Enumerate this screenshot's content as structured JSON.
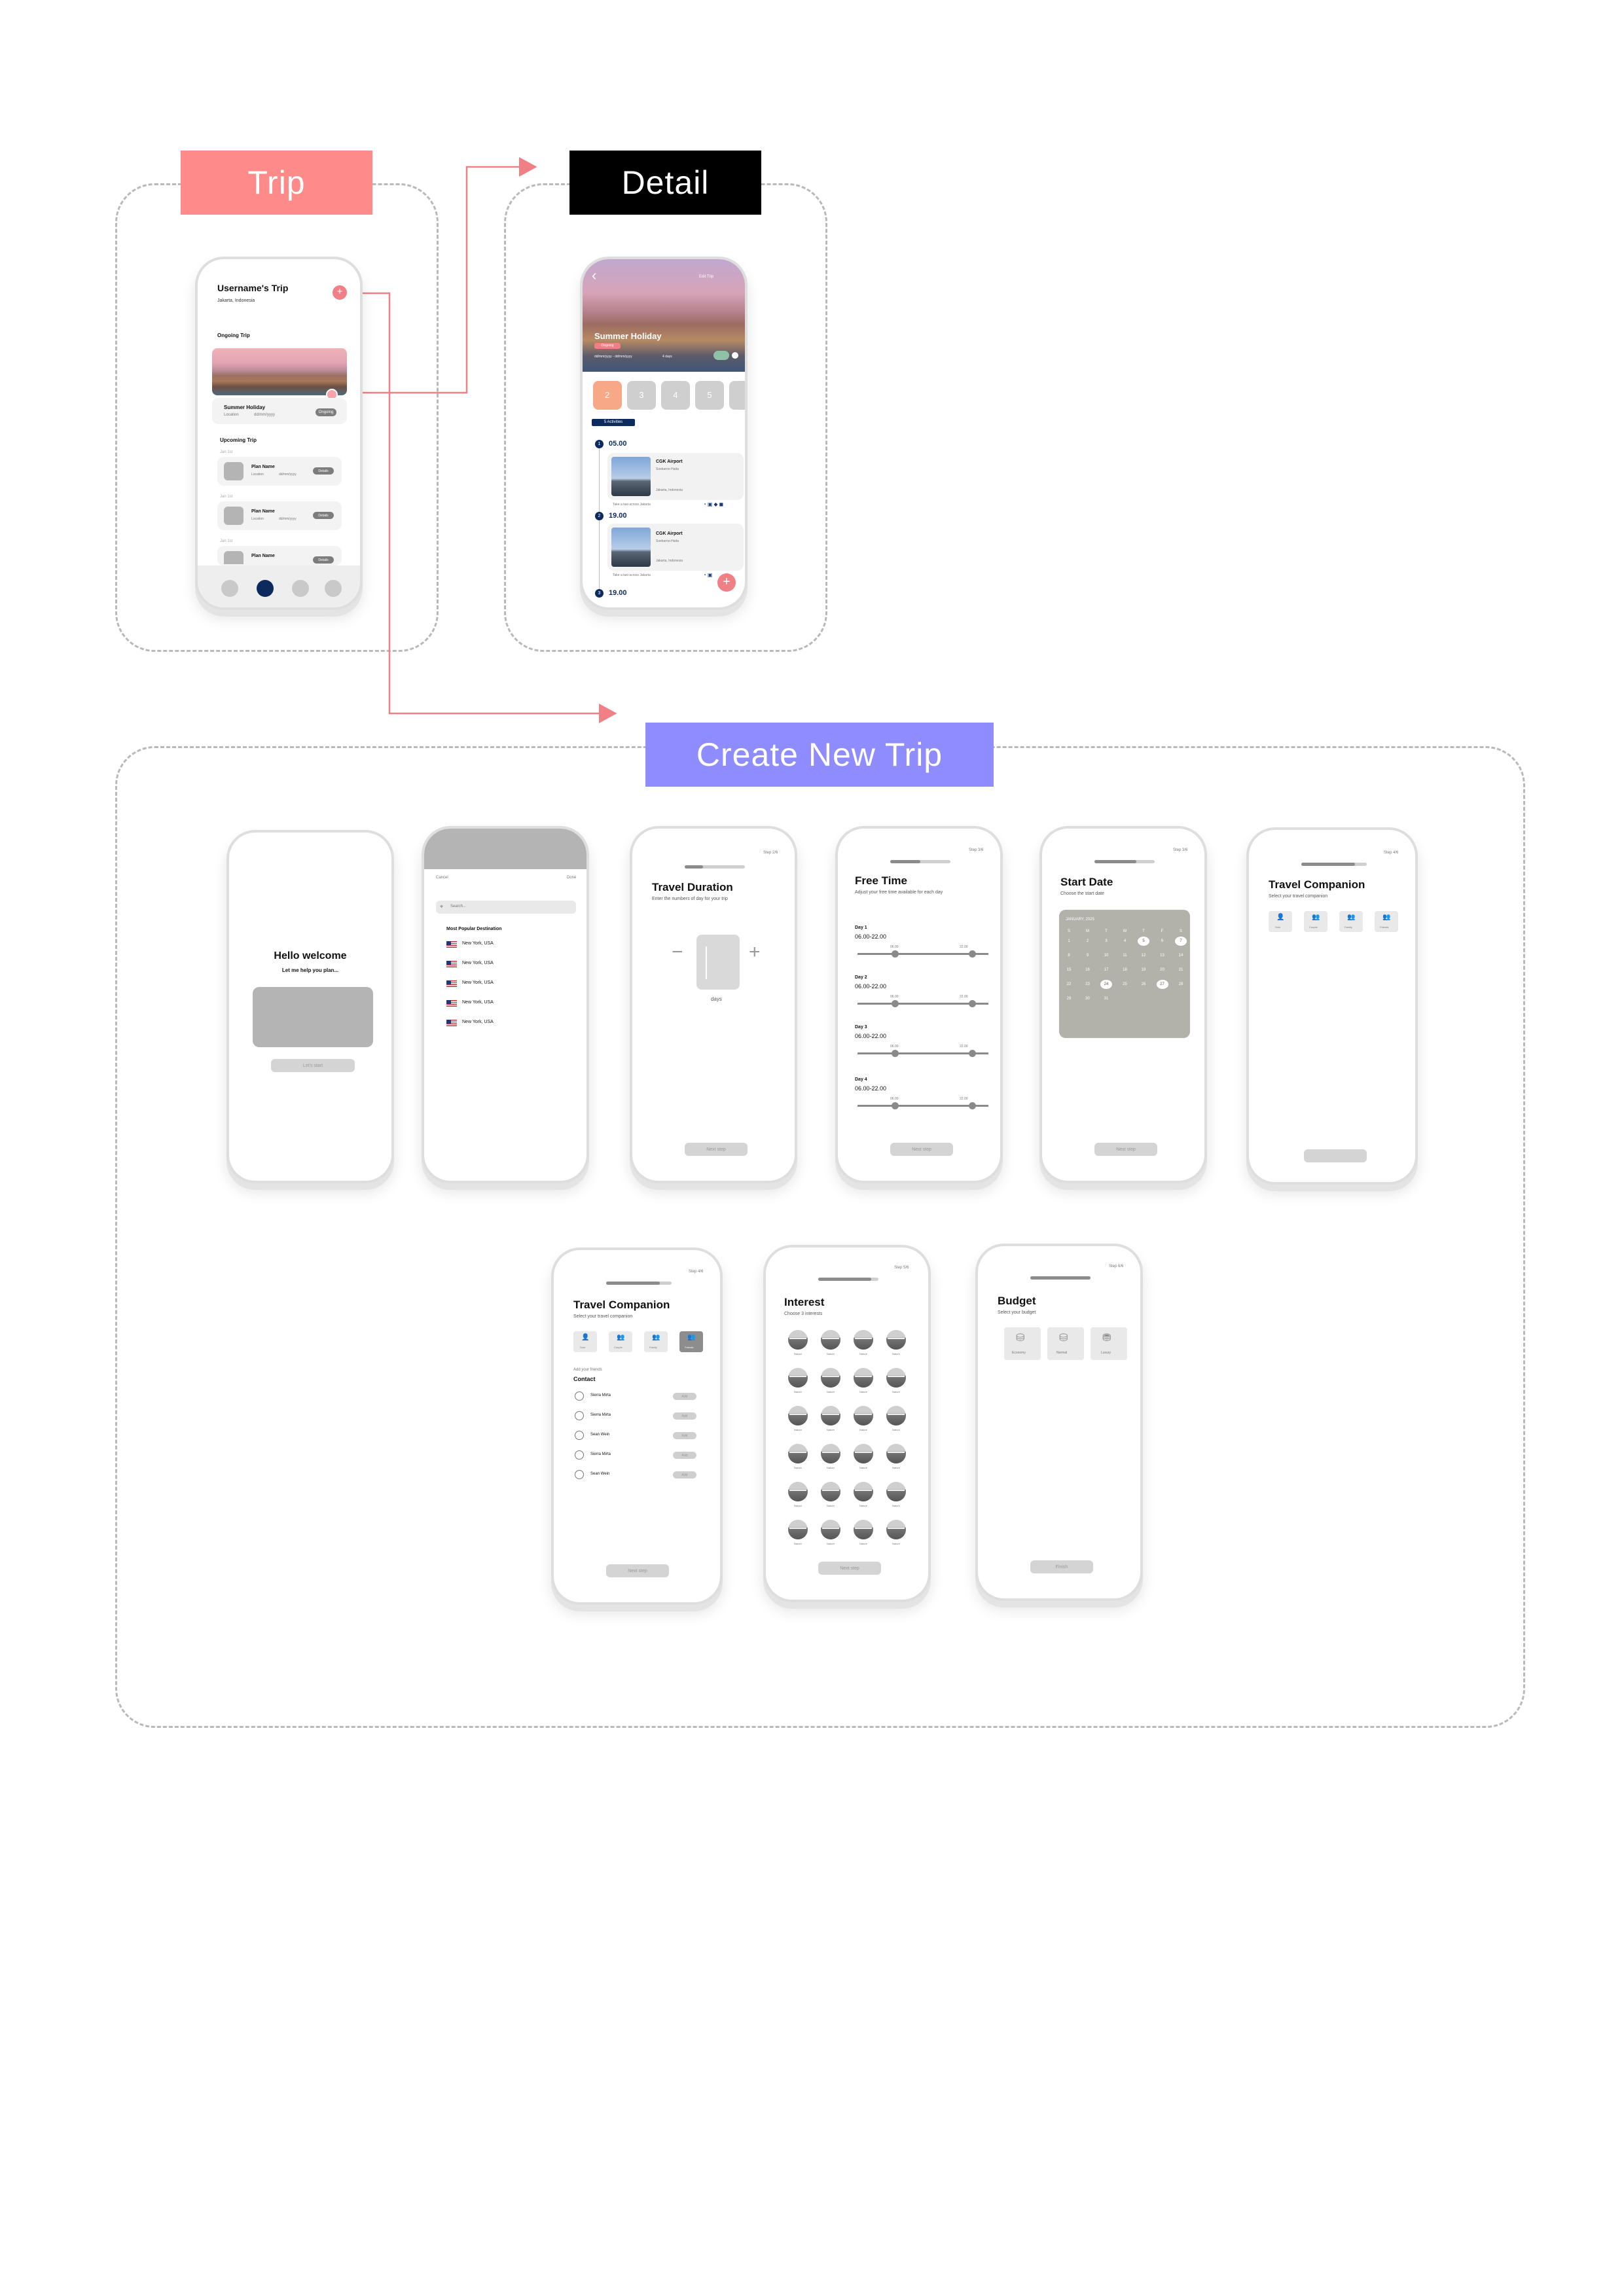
{
  "banners": {
    "trip": "Trip",
    "detail": "Detail",
    "create": "Create New Trip"
  },
  "colors": {
    "trip_banner": "#ff8a8a",
    "detail_banner": "#000000",
    "create_banner": "#8f8cff",
    "connector": "#f07f86",
    "navy": "#0d2a5e"
  },
  "trip_screen": {
    "title": "Username's Trip",
    "location": "Jakarta, Indonesia",
    "ongoing_label": "Ongoing Trip",
    "ongoing": {
      "name": "Summer Holiday",
      "meta_a": "Location",
      "meta_b": "dd/mm/yyyy",
      "tag": "Ongoing"
    },
    "upcoming_label": "Upcoming Trip",
    "upcoming": [
      {
        "date": "Jan 1st",
        "name": "Plan Name",
        "meta_a": "Location",
        "meta_b": "dd/mm/yyyy",
        "tag": "Details"
      },
      {
        "date": "Jan 1st",
        "name": "Plan Name",
        "meta_a": "Location",
        "meta_b": "dd/mm/yyyy",
        "tag": "Details"
      },
      {
        "date": "Jan 1st",
        "name": "Plan Name",
        "meta_a": "",
        "meta_b": "",
        "tag": "Details"
      }
    ]
  },
  "detail_screen": {
    "hero_title": "Summer Holiday",
    "hero_badge": "Ongoing",
    "hero_meta": "dd/mm/yyyy - dd/mm/yyyy",
    "hero_meta2": "4 days",
    "corner_label": "Edit Trip",
    "days": [
      "2",
      "3",
      "4",
      "5"
    ],
    "activities_tag": "5 Activities",
    "timeline": [
      {
        "num": "1",
        "time": "05.00",
        "card_title": "CGK Airport",
        "line_a": "Soekarno-Hatta",
        "line_b": "Jakarta, Indonesia",
        "note": "Take a taxi across Jakarta"
      },
      {
        "num": "2",
        "time": "19.00",
        "card_title": "CGK Airport",
        "line_a": "Soekarno-Hatta",
        "line_b": "Jakarta, Indonesia",
        "note": "Take a taxi across Jakarta"
      },
      {
        "num": "3",
        "time": "19.00"
      }
    ]
  },
  "welcome": {
    "title": "Hello welcome",
    "subtitle": "Let me help you plan...",
    "button": "Let's start"
  },
  "destination": {
    "top_left": "Cancel",
    "top_right": "Done",
    "search": "Search...",
    "heading": "Most Popular Destination",
    "items": [
      "New York, USA",
      "New York, USA",
      "New York, USA",
      "New York, USA",
      "New York, USA"
    ]
  },
  "duration": {
    "step": "Step 2/6",
    "title": "Travel Duration",
    "subtitle": "Enter the numbers of day for your trip",
    "minus": "−",
    "plus": "+",
    "unit": "days",
    "button": "Next step"
  },
  "free_time": {
    "step": "Step 3/6",
    "title": "Free Time",
    "subtitle": "Adjust your free time available for each day",
    "days": [
      {
        "label": "Day 1",
        "range": "06.00-22.00",
        "min": "06.00",
        "max": "22.00"
      },
      {
        "label": "Day 2",
        "range": "06.00-22.00",
        "min": "06.00",
        "max": "22.00"
      },
      {
        "label": "Day 3",
        "range": "06.00-22.00",
        "min": "06.00",
        "max": "22.00"
      },
      {
        "label": "Day 4",
        "range": "06.00-22.00",
        "min": "06.00",
        "max": "22.00"
      }
    ],
    "button": "Next step"
  },
  "start_date": {
    "step": "Step 3/6",
    "title": "Start Date",
    "subtitle": "Choose the start date",
    "month": "JANUARY, 2025",
    "weekdays": [
      "S",
      "M",
      "T",
      "W",
      "T",
      "F",
      "S"
    ],
    "days": [
      "1",
      "2",
      "3",
      "4",
      "5",
      "6",
      "7",
      "8",
      "9",
      "10",
      "11",
      "12",
      "13",
      "14",
      "15",
      "16",
      "17",
      "18",
      "19",
      "20",
      "21",
      "22",
      "23",
      "24",
      "25",
      "26",
      "27",
      "28",
      "29",
      "30",
      "31"
    ],
    "button": "Next step"
  },
  "companion_a": {
    "step": "Step 4/6",
    "title": "Travel Companion",
    "subtitle": "Select your travel companion",
    "options": [
      "Solo",
      "Couple",
      "Family",
      "Friends"
    ]
  },
  "companion_b": {
    "step": "Step 4/6",
    "title": "Travel Companion",
    "subtitle": "Select your travel companion",
    "options": [
      "Solo",
      "Couple",
      "Family",
      "Friends"
    ],
    "add_friends": "Add your friends",
    "contact_label": "Contact",
    "contacts": [
      {
        "name": "Sierra Mirta",
        "action": "Add"
      },
      {
        "name": "Sierra Mirta",
        "action": "Add"
      },
      {
        "name": "Sean Wein",
        "action": "Add"
      },
      {
        "name": "Sierra Mirta",
        "action": "Add"
      },
      {
        "name": "Sean Wein",
        "action": "Add"
      }
    ],
    "button": "Next step"
  },
  "interest": {
    "step": "Step 5/6",
    "title": "Interest",
    "subtitle": "Choose 3 interests",
    "items": [
      "Nature",
      "Nature",
      "Nature",
      "Nature",
      "Nature",
      "Nature",
      "Nature",
      "Nature",
      "Nature",
      "Nature",
      "Nature",
      "Nature",
      "Nature",
      "Nature",
      "Nature",
      "Nature",
      "Nature",
      "Nature",
      "Nature",
      "Nature",
      "Nature",
      "Nature",
      "Nature",
      "Nature"
    ],
    "button": "Next step"
  },
  "budget": {
    "step": "Step 6/6",
    "title": "Budget",
    "subtitle": "Select your budget",
    "options": [
      "Economy",
      "Normal",
      "Luxury"
    ],
    "button": "Finish"
  }
}
